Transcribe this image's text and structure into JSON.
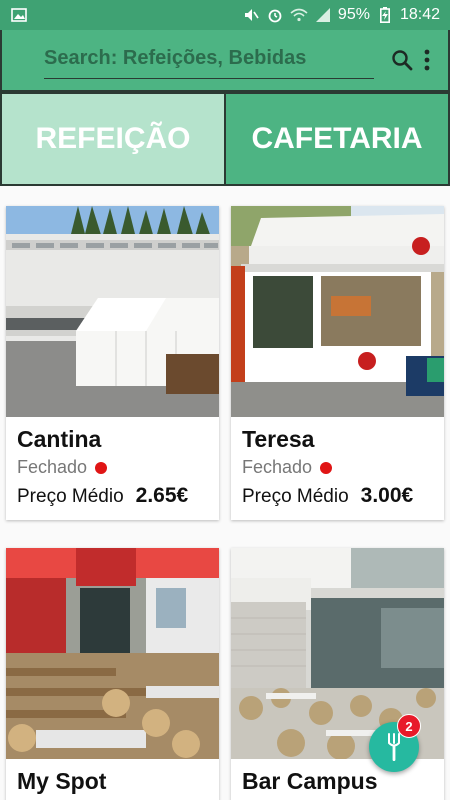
{
  "status_bar": {
    "battery": "95%",
    "time": "18:42",
    "icons": [
      "image-icon",
      "mute-icon",
      "alarm-icon",
      "wifi-icon",
      "signal-icon",
      "battery-charging-icon"
    ]
  },
  "search": {
    "placeholder": "Search: Refeições, Bebidas",
    "value": "",
    "search_icon": "search-icon",
    "menu_icon": "more-vert-icon"
  },
  "tabs": [
    {
      "label": "REFEIÇÃO",
      "active": false
    },
    {
      "label": "CAFETARIA",
      "active": true
    }
  ],
  "colors": {
    "primary": "#4db483",
    "status_bar": "#3fa273",
    "tab_inactive": "#b5e3cc",
    "closed_dot": "#e01515",
    "fab": "#26b9a0",
    "badge": "#e81a2a"
  },
  "cards": [
    {
      "name": "Cantina",
      "status": "Fechado",
      "price_label": "Preço Médio",
      "price": "2.65€"
    },
    {
      "name": "Teresa",
      "status": "Fechado",
      "price_label": "Preço Médio",
      "price": "3.00€"
    },
    {
      "name": "My Spot",
      "status": "",
      "price_label": "",
      "price": ""
    },
    {
      "name": "Bar Campus",
      "status": "",
      "price_label": "",
      "price": ""
    }
  ],
  "fab": {
    "icon": "cutlery-icon",
    "badge_count": "2"
  }
}
